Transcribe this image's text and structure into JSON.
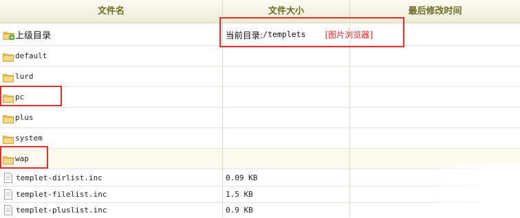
{
  "header": {
    "col_name": "文件名",
    "col_size": "文件大小",
    "col_modified": "最后修改时间"
  },
  "parent_row": {
    "label": "上级目录",
    "current_dir_label": "当前目录:",
    "current_dir_path": "/templets",
    "image_browser_link": "[图片浏览器]"
  },
  "folders": [
    {
      "name": "default"
    },
    {
      "name": "lurd"
    },
    {
      "name": "pc"
    },
    {
      "name": "plus"
    },
    {
      "name": "system"
    },
    {
      "name": "wap"
    }
  ],
  "files": [
    {
      "name": "templet-dirlist.inc",
      "size": "0.09 KB"
    },
    {
      "name": "templet-filelist.inc",
      "size": "1.5 KB"
    },
    {
      "name": "templet-pluslist.inc",
      "size": "0.9 KB"
    }
  ],
  "colors": {
    "header_text": "#6b6b25",
    "highlight_border": "#dd2f2f",
    "link": "#e0241f",
    "folder": "#f2c45a"
  },
  "icons": {
    "parent": "folder-up-arrow-icon",
    "folder": "folder-icon",
    "file": "document-icon"
  }
}
